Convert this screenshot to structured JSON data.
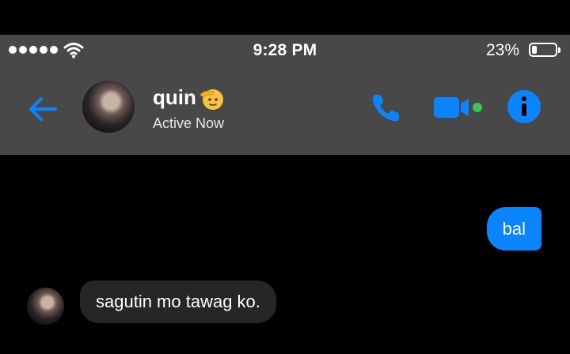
{
  "status_bar": {
    "signal_bars": 5,
    "time": "9:28 PM",
    "battery_percent": "23%",
    "battery_level": 0.23
  },
  "header": {
    "contact_name": "quin",
    "name_emoji": "saluting-face-emoji",
    "status": "Active Now",
    "icons": {
      "back": "back-arrow-icon",
      "call": "phone-icon",
      "video": "video-camera-icon",
      "info": "info-icon"
    },
    "accent_color": "#0a84ff",
    "online_color": "#34c759"
  },
  "messages": [
    {
      "direction": "outgoing",
      "text": "bal"
    },
    {
      "direction": "incoming",
      "text": "sagutin mo tawag ko."
    }
  ]
}
